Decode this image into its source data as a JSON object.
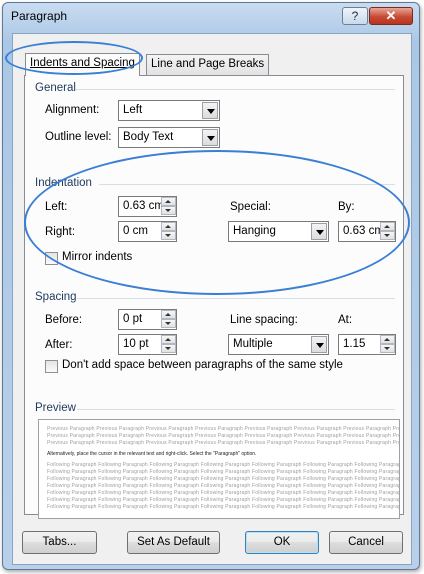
{
  "window": {
    "title": "Paragraph",
    "help_label": "?",
    "close_label": "✕"
  },
  "tabs": [
    {
      "label": "Indents and Spacing",
      "mnemonic": "I",
      "active": true
    },
    {
      "label": "Line and Page Breaks",
      "mnemonic": "P",
      "active": false
    }
  ],
  "general": {
    "title": "General",
    "alignment_label": "Alignment:",
    "alignment_value": "Left",
    "outline_label": "Outline level:",
    "outline_value": "Body Text"
  },
  "indentation": {
    "title": "Indentation",
    "left_label": "Left:",
    "left_value": "0.63 cm",
    "right_label": "Right:",
    "right_value": "0 cm",
    "special_label": "Special:",
    "special_value": "Hanging",
    "by_label": "By:",
    "by_value": "0.63 cm",
    "mirror_label": "Mirror indents",
    "mirror_checked": false
  },
  "spacing": {
    "title": "Spacing",
    "before_label": "Before:",
    "before_value": "0 pt",
    "after_label": "After:",
    "after_value": "10 pt",
    "line_spacing_label": "Line spacing:",
    "line_spacing_value": "Multiple",
    "at_label": "At:",
    "at_value": "1.15",
    "dont_add_label": "Don't add space between paragraphs of the same style",
    "dont_add_checked": false
  },
  "preview": {
    "title": "Preview",
    "previous_text": "Previous Paragraph Previous Paragraph Previous Paragraph Previous Paragraph Previous Paragraph Previous Paragraph Previous Paragraph Previous Paragraph",
    "current_text": "Alternatively, place the cursor in the relevant text and right-click. Select the \"Paragraph\" option.",
    "following_text": "Following Paragraph Following Paragraph Following Paragraph Following Paragraph Following Paragraph Following Paragraph Following Paragraph"
  },
  "buttons": {
    "tabs": "Tabs...",
    "set_default": "Set As Default",
    "ok": "OK",
    "cancel": "Cancel"
  },
  "colors": {
    "annotation": "#3a7fd5",
    "section_title": "#1e395b"
  }
}
